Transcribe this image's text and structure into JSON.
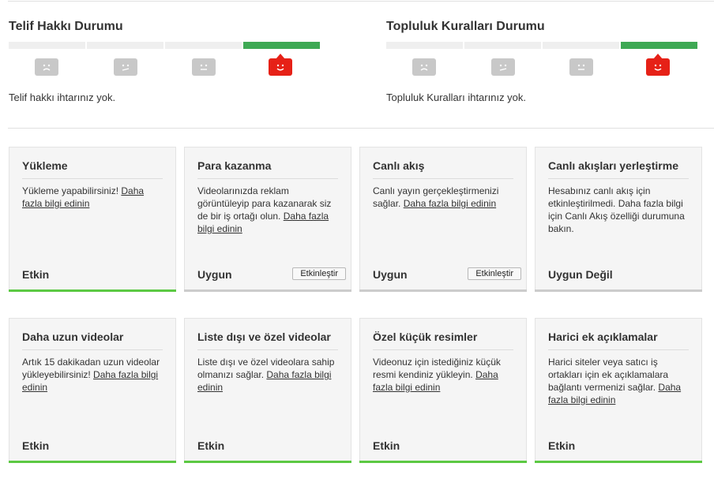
{
  "copyright": {
    "title": "Telif Hakkı Durumu",
    "message": "Telif hakkı ihtarınız yok.",
    "level": 4
  },
  "community": {
    "title": "Topluluk Kuralları Durumu",
    "message": "Topluluk Kuralları ihtarınız yok.",
    "level": 4
  },
  "colors": {
    "good": "#3ea954",
    "active_face": "#e62117",
    "inactive_face": "#c8c8c8",
    "enabled_bar": "#5cc943"
  },
  "features": [
    {
      "title": "Yükleme",
      "desc": "Yükleme yapabilirsiniz! ",
      "link": "Daha fazla bilgi edinin",
      "state": "Etkin",
      "button": ""
    },
    {
      "title": "Para kazanma",
      "desc": "Videolarınızda reklam görüntüleyip para kazanarak siz de bir iş ortağı olun. ",
      "link": "Daha fazla bilgi edinin",
      "state": "Uygun",
      "button": "Etkinleştir"
    },
    {
      "title": "Canlı akış",
      "desc": "Canlı yayın gerçekleştirmenizi sağlar. ",
      "link": "Daha fazla bilgi edinin",
      "state": "Uygun",
      "button": "Etkinleştir"
    },
    {
      "title": "Canlı akışları yerleştirme",
      "desc": "Hesabınız canlı akış için etkinleştirilmedi. Daha fazla bilgi için Canlı Akış özelliği durumuna bakın.",
      "link": "",
      "state": "Uygun Değil",
      "button": ""
    },
    {
      "title": "Daha uzun videolar",
      "desc": "Artık 15 dakikadan uzun videolar yükleyebilirsiniz! ",
      "link": "Daha fazla bilgi edinin",
      "state": "Etkin",
      "button": ""
    },
    {
      "title": "Liste dışı ve özel videolar",
      "desc": "Liste dışı ve özel videolara sahip olmanızı sağlar. ",
      "link": "Daha fazla bilgi edinin",
      "state": "Etkin",
      "button": ""
    },
    {
      "title": "Özel küçük resimler",
      "desc": "Videonuz için istediğiniz küçük resmi kendiniz yükleyin. ",
      "link": "Daha fazla bilgi edinin",
      "state": "Etkin",
      "button": ""
    },
    {
      "title": "Harici ek açıklamalar",
      "desc": "Harici siteler veya satıcı iş ortakları için ek açıklamalara bağlantı vermenizi sağlar. ",
      "link": "Daha fazla bilgi edinin",
      "state": "Etkin",
      "button": ""
    }
  ]
}
